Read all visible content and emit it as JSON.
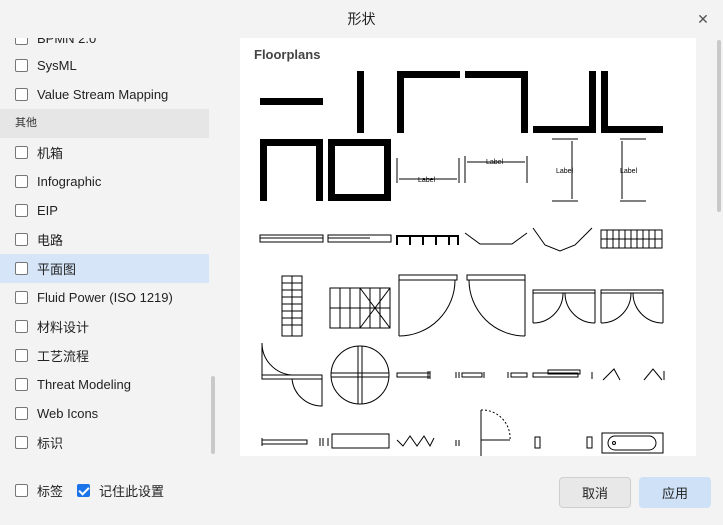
{
  "dialog": {
    "title": "形状"
  },
  "sidebar": {
    "items": [
      {
        "label": "BPMN 2.0",
        "checked": false
      },
      {
        "label": "SysML",
        "checked": false
      },
      {
        "label": "Value Stream Mapping",
        "checked": false
      }
    ],
    "group_label": "其他",
    "other_items": [
      {
        "label": "机箱",
        "checked": false
      },
      {
        "label": "Infographic",
        "checked": false
      },
      {
        "label": "EIP",
        "checked": false
      },
      {
        "label": "电路",
        "checked": false
      },
      {
        "label": "平面图",
        "checked": false,
        "selected": true
      },
      {
        "label": "Fluid Power (ISO 1219)",
        "checked": false
      },
      {
        "label": "材料设计",
        "checked": false
      },
      {
        "label": "工艺流程",
        "checked": false
      },
      {
        "label": "Threat Modeling",
        "checked": false
      },
      {
        "label": "Web Icons",
        "checked": false
      },
      {
        "label": "标识",
        "checked": false
      }
    ]
  },
  "preview": {
    "section_title": "Floorplans",
    "dim_label": "Label"
  },
  "footer": {
    "labels_checkbox": "标签",
    "labels_checked": false,
    "remember_checkbox": "记住此设置",
    "remember_checked": true,
    "cancel_label": "取消",
    "apply_label": "应用"
  },
  "colors": {
    "accent": "#1a73e8",
    "selected_row": "#d6e6f8",
    "apply_button": "#cfe1f7"
  }
}
